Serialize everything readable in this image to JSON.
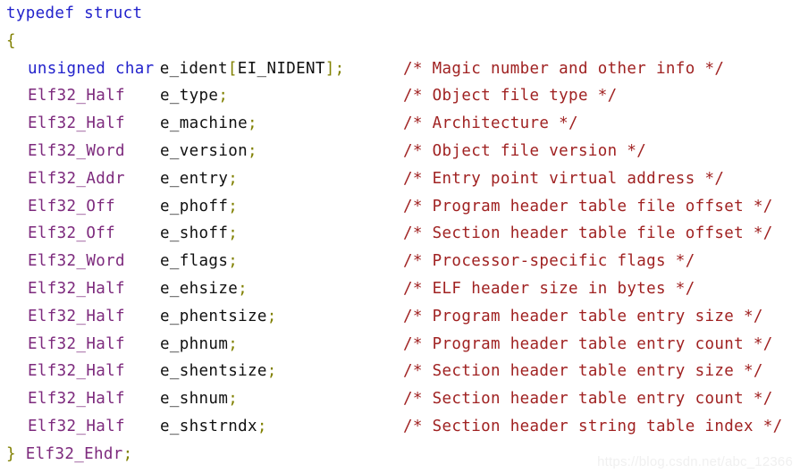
{
  "code": {
    "language": "c",
    "header_lines": [
      {
        "indent": "flush",
        "segments": [
          {
            "kind": "keyword",
            "text": "typedef struct"
          }
        ]
      },
      {
        "indent": "flush",
        "segments": [
          {
            "kind": "punct",
            "text": "{"
          }
        ]
      }
    ],
    "declarations": [
      {
        "type_text": "unsigned char",
        "type_kind": "keyword",
        "name_inline": true,
        "name_segments": [
          {
            "kind": "ident",
            "text": "e_ident"
          },
          {
            "kind": "punct",
            "text": "["
          },
          {
            "kind": "ident",
            "text": "EI_NIDENT"
          },
          {
            "kind": "punct",
            "text": "]"
          },
          {
            "kind": "punct",
            "text": ";"
          }
        ],
        "name_plain": "e_ident[EI_NIDENT];",
        "comment": "/* Magic number and other info */"
      },
      {
        "type_text": "Elf32_Half",
        "type_kind": "type",
        "name_inline": false,
        "name_segments": [
          {
            "kind": "ident",
            "text": "e_type"
          },
          {
            "kind": "punct",
            "text": ";"
          }
        ],
        "name_plain": "e_type;",
        "comment": "/* Object file type */"
      },
      {
        "type_text": "Elf32_Half",
        "type_kind": "type",
        "name_inline": false,
        "name_segments": [
          {
            "kind": "ident",
            "text": "e_machine"
          },
          {
            "kind": "punct",
            "text": ";"
          }
        ],
        "name_plain": "e_machine;",
        "comment": "/* Architecture */"
      },
      {
        "type_text": "Elf32_Word",
        "type_kind": "type",
        "name_inline": false,
        "name_segments": [
          {
            "kind": "ident",
            "text": "e_version"
          },
          {
            "kind": "punct",
            "text": ";"
          }
        ],
        "name_plain": "e_version;",
        "comment": "/* Object file version */"
      },
      {
        "type_text": "Elf32_Addr",
        "type_kind": "type",
        "name_inline": false,
        "name_segments": [
          {
            "kind": "ident",
            "text": "e_entry"
          },
          {
            "kind": "punct",
            "text": ";"
          }
        ],
        "name_plain": "e_entry;",
        "comment": "/* Entry point virtual address */"
      },
      {
        "type_text": "Elf32_Off",
        "type_kind": "type",
        "name_inline": false,
        "name_segments": [
          {
            "kind": "ident",
            "text": "e_phoff"
          },
          {
            "kind": "punct",
            "text": ";"
          }
        ],
        "name_plain": "e_phoff;",
        "comment": "/* Program header table file offset */"
      },
      {
        "type_text": "Elf32_Off",
        "type_kind": "type",
        "name_inline": false,
        "name_segments": [
          {
            "kind": "ident",
            "text": "e_shoff"
          },
          {
            "kind": "punct",
            "text": ";"
          }
        ],
        "name_plain": "e_shoff;",
        "comment": "/* Section header table file offset */"
      },
      {
        "type_text": "Elf32_Word",
        "type_kind": "type",
        "name_inline": false,
        "name_segments": [
          {
            "kind": "ident",
            "text": "e_flags"
          },
          {
            "kind": "punct",
            "text": ";"
          }
        ],
        "name_plain": "e_flags;",
        "comment": "/* Processor-specific flags */"
      },
      {
        "type_text": "Elf32_Half",
        "type_kind": "type",
        "name_inline": false,
        "name_segments": [
          {
            "kind": "ident",
            "text": "e_ehsize"
          },
          {
            "kind": "punct",
            "text": ";"
          }
        ],
        "name_plain": "e_ehsize;",
        "comment": "/* ELF header size in bytes */"
      },
      {
        "type_text": "Elf32_Half",
        "type_kind": "type",
        "name_inline": false,
        "name_segments": [
          {
            "kind": "ident",
            "text": "e_phentsize"
          },
          {
            "kind": "punct",
            "text": ";"
          }
        ],
        "name_plain": "e_phentsize;",
        "comment": "/* Program header table entry size */"
      },
      {
        "type_text": "Elf32_Half",
        "type_kind": "type",
        "name_inline": false,
        "name_segments": [
          {
            "kind": "ident",
            "text": "e_phnum"
          },
          {
            "kind": "punct",
            "text": ";"
          }
        ],
        "name_plain": "e_phnum;",
        "comment": "/* Program header table entry count */"
      },
      {
        "type_text": "Elf32_Half",
        "type_kind": "type",
        "name_inline": false,
        "name_segments": [
          {
            "kind": "ident",
            "text": "e_shentsize"
          },
          {
            "kind": "punct",
            "text": ";"
          }
        ],
        "name_plain": "e_shentsize;",
        "comment": "/* Section header table entry size */"
      },
      {
        "type_text": "Elf32_Half",
        "type_kind": "type",
        "name_inline": false,
        "name_segments": [
          {
            "kind": "ident",
            "text": "e_shnum"
          },
          {
            "kind": "punct",
            "text": ";"
          }
        ],
        "name_plain": "e_shnum;",
        "comment": "/* Section header table entry count */"
      },
      {
        "type_text": "Elf32_Half",
        "type_kind": "type",
        "name_inline": false,
        "name_segments": [
          {
            "kind": "ident",
            "text": "e_shstrndx"
          },
          {
            "kind": "punct",
            "text": ";"
          }
        ],
        "name_plain": "e_shstrndx;",
        "comment": "/* Section header string table index */"
      }
    ],
    "footer_line": {
      "segments": [
        {
          "kind": "punct",
          "text": "}"
        },
        {
          "kind": "plain",
          "text": " "
        },
        {
          "kind": "type",
          "text": "Elf32_Ehdr"
        },
        {
          "kind": "punct",
          "text": ";"
        }
      ],
      "plain": "} Elf32_Ehdr;"
    }
  },
  "watermark": {
    "text": "https://blog.csdn.net/abc_12366"
  },
  "colors": {
    "background": "#ffffff",
    "keyword": "#2222cc",
    "type": "#7d2a7d",
    "identifier": "#111111",
    "punctuation": "#808000",
    "comment": "#a02222",
    "watermark": "#f0f0f0"
  }
}
